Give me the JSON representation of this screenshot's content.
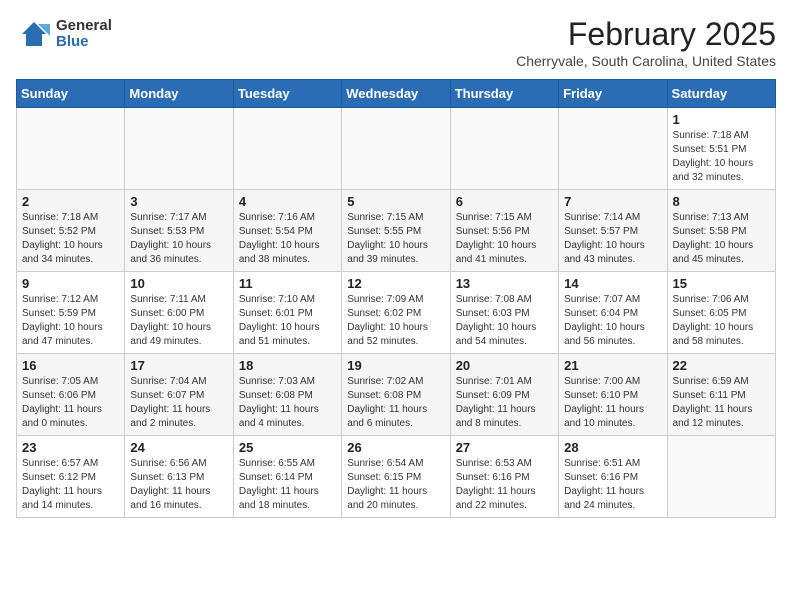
{
  "header": {
    "logo_general": "General",
    "logo_blue": "Blue",
    "month_year": "February 2025",
    "location": "Cherryvale, South Carolina, United States"
  },
  "days_of_week": [
    "Sunday",
    "Monday",
    "Tuesday",
    "Wednesday",
    "Thursday",
    "Friday",
    "Saturday"
  ],
  "weeks": [
    [
      {
        "day": "",
        "info": ""
      },
      {
        "day": "",
        "info": ""
      },
      {
        "day": "",
        "info": ""
      },
      {
        "day": "",
        "info": ""
      },
      {
        "day": "",
        "info": ""
      },
      {
        "day": "",
        "info": ""
      },
      {
        "day": "1",
        "info": "Sunrise: 7:18 AM\nSunset: 5:51 PM\nDaylight: 10 hours and 32 minutes."
      }
    ],
    [
      {
        "day": "2",
        "info": "Sunrise: 7:18 AM\nSunset: 5:52 PM\nDaylight: 10 hours and 34 minutes."
      },
      {
        "day": "3",
        "info": "Sunrise: 7:17 AM\nSunset: 5:53 PM\nDaylight: 10 hours and 36 minutes."
      },
      {
        "day": "4",
        "info": "Sunrise: 7:16 AM\nSunset: 5:54 PM\nDaylight: 10 hours and 38 minutes."
      },
      {
        "day": "5",
        "info": "Sunrise: 7:15 AM\nSunset: 5:55 PM\nDaylight: 10 hours and 39 minutes."
      },
      {
        "day": "6",
        "info": "Sunrise: 7:15 AM\nSunset: 5:56 PM\nDaylight: 10 hours and 41 minutes."
      },
      {
        "day": "7",
        "info": "Sunrise: 7:14 AM\nSunset: 5:57 PM\nDaylight: 10 hours and 43 minutes."
      },
      {
        "day": "8",
        "info": "Sunrise: 7:13 AM\nSunset: 5:58 PM\nDaylight: 10 hours and 45 minutes."
      }
    ],
    [
      {
        "day": "9",
        "info": "Sunrise: 7:12 AM\nSunset: 5:59 PM\nDaylight: 10 hours and 47 minutes."
      },
      {
        "day": "10",
        "info": "Sunrise: 7:11 AM\nSunset: 6:00 PM\nDaylight: 10 hours and 49 minutes."
      },
      {
        "day": "11",
        "info": "Sunrise: 7:10 AM\nSunset: 6:01 PM\nDaylight: 10 hours and 51 minutes."
      },
      {
        "day": "12",
        "info": "Sunrise: 7:09 AM\nSunset: 6:02 PM\nDaylight: 10 hours and 52 minutes."
      },
      {
        "day": "13",
        "info": "Sunrise: 7:08 AM\nSunset: 6:03 PM\nDaylight: 10 hours and 54 minutes."
      },
      {
        "day": "14",
        "info": "Sunrise: 7:07 AM\nSunset: 6:04 PM\nDaylight: 10 hours and 56 minutes."
      },
      {
        "day": "15",
        "info": "Sunrise: 7:06 AM\nSunset: 6:05 PM\nDaylight: 10 hours and 58 minutes."
      }
    ],
    [
      {
        "day": "16",
        "info": "Sunrise: 7:05 AM\nSunset: 6:06 PM\nDaylight: 11 hours and 0 minutes."
      },
      {
        "day": "17",
        "info": "Sunrise: 7:04 AM\nSunset: 6:07 PM\nDaylight: 11 hours and 2 minutes."
      },
      {
        "day": "18",
        "info": "Sunrise: 7:03 AM\nSunset: 6:08 PM\nDaylight: 11 hours and 4 minutes."
      },
      {
        "day": "19",
        "info": "Sunrise: 7:02 AM\nSunset: 6:08 PM\nDaylight: 11 hours and 6 minutes."
      },
      {
        "day": "20",
        "info": "Sunrise: 7:01 AM\nSunset: 6:09 PM\nDaylight: 11 hours and 8 minutes."
      },
      {
        "day": "21",
        "info": "Sunrise: 7:00 AM\nSunset: 6:10 PM\nDaylight: 11 hours and 10 minutes."
      },
      {
        "day": "22",
        "info": "Sunrise: 6:59 AM\nSunset: 6:11 PM\nDaylight: 11 hours and 12 minutes."
      }
    ],
    [
      {
        "day": "23",
        "info": "Sunrise: 6:57 AM\nSunset: 6:12 PM\nDaylight: 11 hours and 14 minutes."
      },
      {
        "day": "24",
        "info": "Sunrise: 6:56 AM\nSunset: 6:13 PM\nDaylight: 11 hours and 16 minutes."
      },
      {
        "day": "25",
        "info": "Sunrise: 6:55 AM\nSunset: 6:14 PM\nDaylight: 11 hours and 18 minutes."
      },
      {
        "day": "26",
        "info": "Sunrise: 6:54 AM\nSunset: 6:15 PM\nDaylight: 11 hours and 20 minutes."
      },
      {
        "day": "27",
        "info": "Sunrise: 6:53 AM\nSunset: 6:16 PM\nDaylight: 11 hours and 22 minutes."
      },
      {
        "day": "28",
        "info": "Sunrise: 6:51 AM\nSunset: 6:16 PM\nDaylight: 11 hours and 24 minutes."
      },
      {
        "day": "",
        "info": ""
      }
    ]
  ]
}
